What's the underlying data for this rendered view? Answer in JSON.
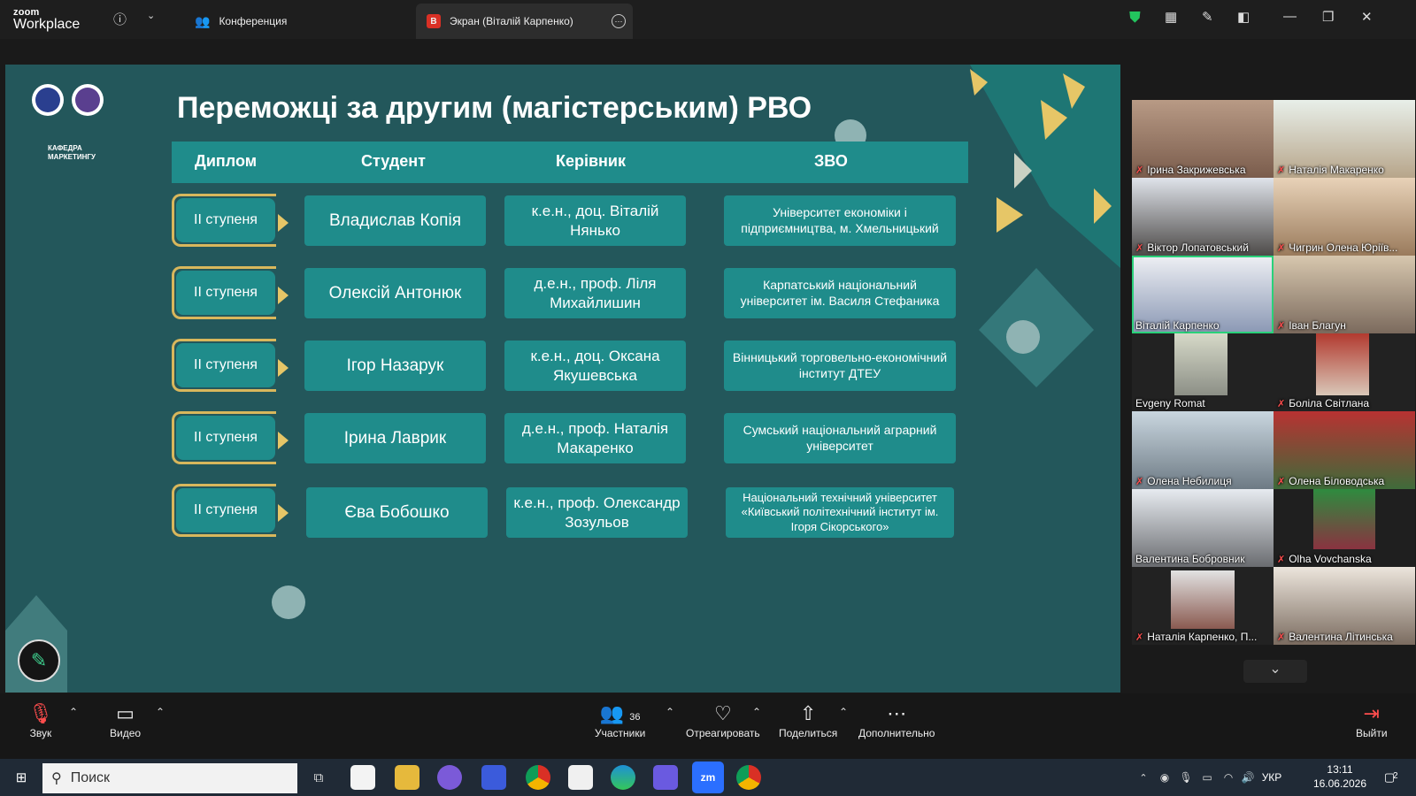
{
  "app": {
    "logo_small": "zoom",
    "logo_large": "Workplace"
  },
  "tabs": [
    {
      "label": "Конференция"
    },
    {
      "label": "Экран (Віталій Карпенко)",
      "badge": "В"
    }
  ],
  "slide": {
    "title": "Переможці за другим (магістерським) РВО",
    "logo_text": "КАФЕДРА МАРКЕТИНГУ",
    "headers": [
      "Диплом",
      "Студент",
      "Керівник",
      "ЗВО"
    ],
    "rows": [
      {
        "diploma": "ІІ ступеня",
        "student": "Владислав Копія",
        "supervisor": "к.е.н., доц. Віталій Нянько",
        "university": "Університет економіки і підприємництва, м. Хмельницький"
      },
      {
        "diploma": "ІІ ступеня",
        "student": "Олексій Антонюк",
        "supervisor": "д.е.н., проф. Ліля Михайлишин",
        "university": "Карпатський національний університет ім. Василя Стефаника"
      },
      {
        "diploma": "ІІ ступеня",
        "student": "Ігор Назарук",
        "supervisor": "к.е.н., доц. Оксана Якушевська",
        "university": "Вінницький торговельно-економічний інститут ДТЕУ"
      },
      {
        "diploma": "ІІ ступеня",
        "student": "Ірина Лаврик",
        "supervisor": "д.е.н., проф. Наталія Макаренко",
        "university": "Сумський національний аграрний університет"
      },
      {
        "diploma": "ІІ ступеня",
        "student": "Єва Бобошко",
        "supervisor": "к.е.н., проф. Олександр Зозульов",
        "university": "Національний технічний університет «Київський політехнічний інститут ім. Ігоря Сікорського»"
      }
    ]
  },
  "participants": [
    {
      "name": "Ірина Закрижевська",
      "muted": true
    },
    {
      "name": "Наталія Макаренко",
      "muted": true
    },
    {
      "name": "Віктор Лопатовський",
      "muted": true
    },
    {
      "name": "Чигрин Олена Юріїв...",
      "muted": true
    },
    {
      "name": "Віталій Карпенко",
      "muted": false
    },
    {
      "name": "Іван Благун",
      "muted": true
    },
    {
      "name": "Evgeny Romat",
      "muted": false
    },
    {
      "name": "Боліла  Світлана",
      "muted": true
    },
    {
      "name": "Олена Небилиця",
      "muted": true
    },
    {
      "name": "Олена Біловодська",
      "muted": true
    },
    {
      "name": "Валентина Бобровник",
      "muted": false
    },
    {
      "name": "Olha Vovchanska",
      "muted": true
    },
    {
      "name": "Наталія Карпенко, П...",
      "muted": true
    },
    {
      "name": "Валентина Літинська",
      "muted": true
    }
  ],
  "controls": {
    "audio": "Звук",
    "video": "Видео",
    "participants": "Участники",
    "participants_count": "36",
    "react": "Отреагировать",
    "share": "Поделиться",
    "more": "Дополнительно",
    "leave": "Выйти"
  },
  "taskbar": {
    "search_placeholder": "Поиск",
    "lang": "УКР",
    "time": "13:11",
    "date": "16.06.2026",
    "notifications": "2"
  }
}
